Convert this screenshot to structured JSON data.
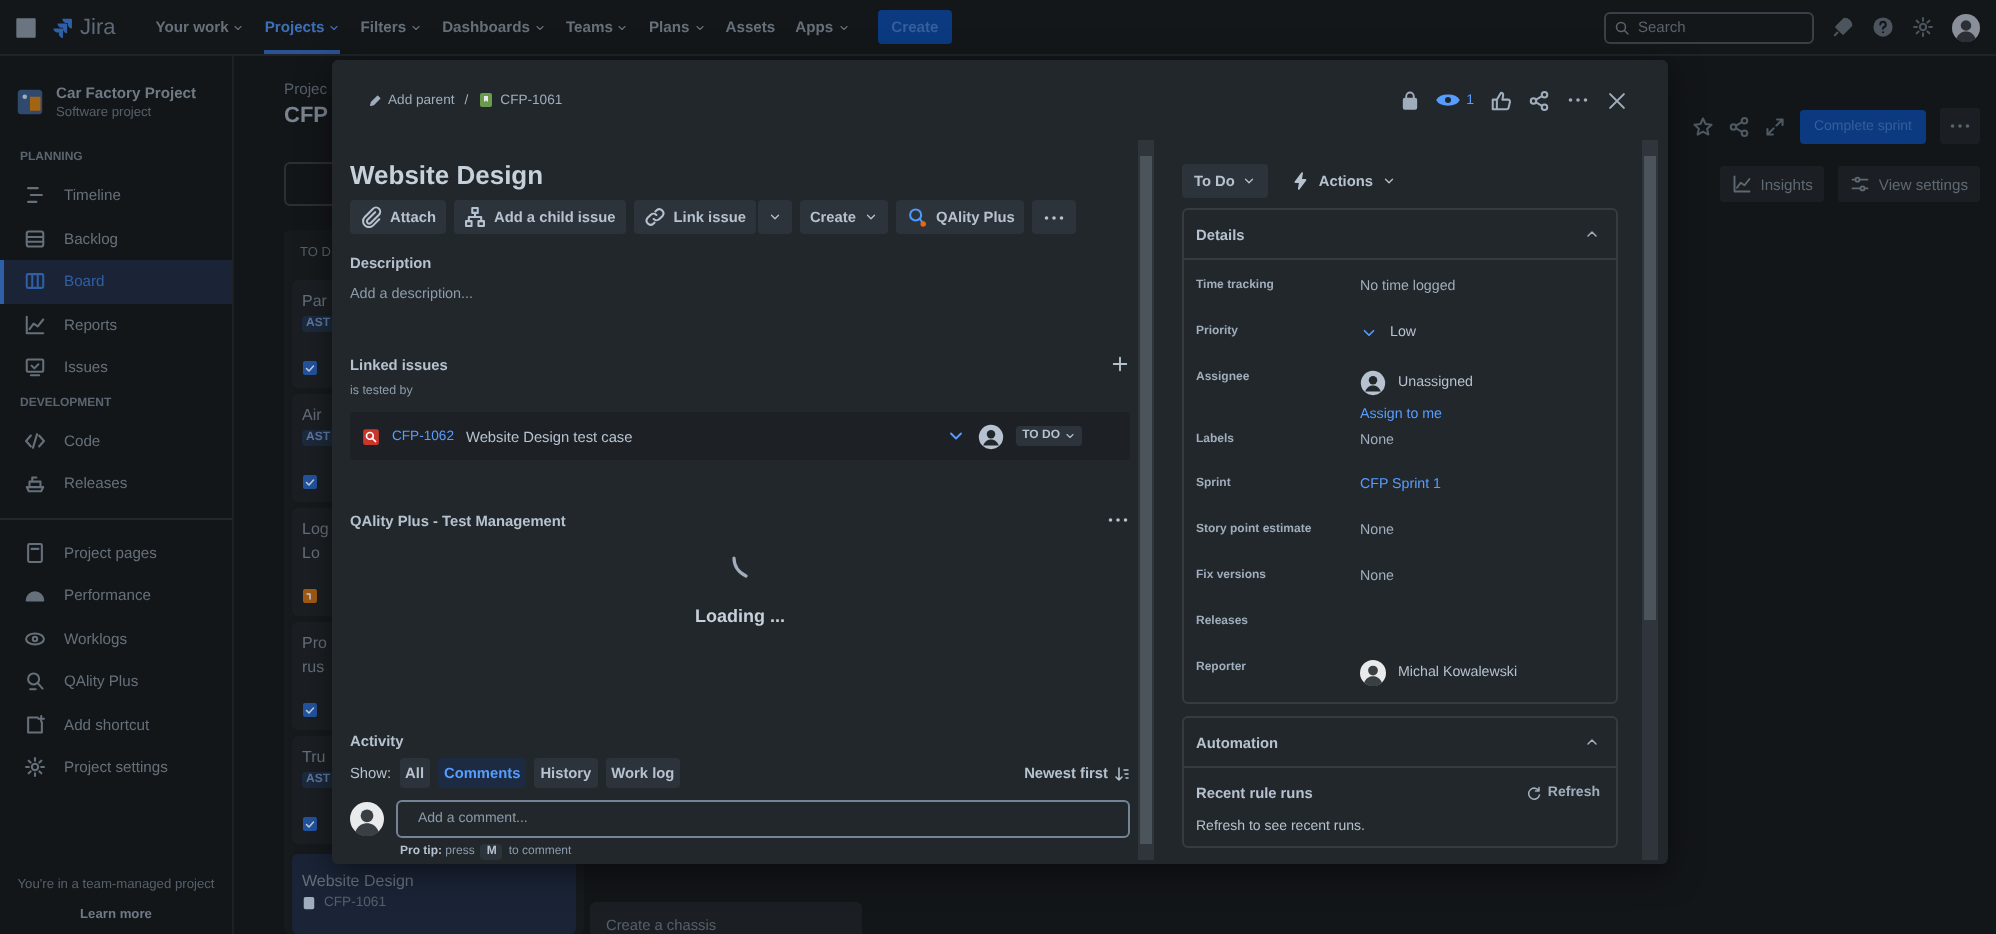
{
  "topnav": {
    "logo": "Jira",
    "items": [
      {
        "label": "Your work",
        "dropdown": true,
        "selected": false
      },
      {
        "label": "Projects",
        "dropdown": true,
        "selected": true
      },
      {
        "label": "Filters",
        "dropdown": true,
        "selected": false
      },
      {
        "label": "Dashboards",
        "dropdown": true,
        "selected": false
      },
      {
        "label": "Teams",
        "dropdown": true,
        "selected": false
      },
      {
        "label": "Plans",
        "dropdown": true,
        "selected": false
      },
      {
        "label": "Assets",
        "dropdown": false,
        "selected": false
      },
      {
        "label": "Apps",
        "dropdown": true,
        "selected": false
      }
    ],
    "create": "Create",
    "search": {
      "placeholder": "Search"
    }
  },
  "sidebar": {
    "project": {
      "name": "Car Factory Project",
      "type": "Software project"
    },
    "groups": [
      {
        "heading": "PLANNING",
        "items": [
          {
            "label": "Timeline",
            "kind": "timeline",
            "selected": false
          },
          {
            "label": "Backlog",
            "kind": "backlog",
            "selected": false
          },
          {
            "label": "Board",
            "kind": "board",
            "selected": true
          },
          {
            "label": "Reports",
            "kind": "reports",
            "selected": false
          },
          {
            "label": "Issues",
            "kind": "issues",
            "selected": false
          }
        ]
      },
      {
        "heading": "DEVELOPMENT",
        "items": [
          {
            "label": "Code",
            "kind": "code",
            "selected": false
          },
          {
            "label": "Releases",
            "kind": "releases",
            "selected": false
          }
        ]
      },
      {
        "items": [
          {
            "label": "Project pages",
            "kind": "pages",
            "selected": false
          },
          {
            "label": "Performance",
            "kind": "performance",
            "selected": false
          },
          {
            "label": "Worklogs",
            "kind": "worklogs",
            "selected": false
          },
          {
            "label": "QAlity Plus",
            "kind": "qality",
            "selected": false
          },
          {
            "label": "Add shortcut",
            "kind": "shortcut",
            "selected": false
          },
          {
            "label": "Project settings",
            "kind": "settings",
            "selected": false
          }
        ]
      }
    ],
    "footer": "You're in a team-managed project",
    "learn_more": "Learn more"
  },
  "board": {
    "breadcrumb": "Projec",
    "title": "CFP",
    "complete_sprint": "Complete sprint",
    "insights": "Insights",
    "view_settings": "View settings",
    "column_header": "TO D",
    "cards": [
      {
        "lines": [
          "Par"
        ],
        "tag": "AST",
        "kind": "task"
      },
      {
        "lines": [
          "Air"
        ],
        "tag": "AST",
        "kind": "task"
      },
      {
        "lines": [
          "Log",
          "Lo"
        ],
        "kind": "other"
      },
      {
        "lines": [
          "Pro",
          "rus"
        ],
        "kind": "task"
      },
      {
        "lines": [
          "Tru"
        ],
        "tag": "AST",
        "kind": "task"
      }
    ],
    "selected_card": {
      "title": "Website Design",
      "key": "CFP-1061"
    },
    "create_card": "Create a chassis"
  },
  "issue": {
    "breadcrumb": {
      "parent": "Add parent",
      "separator": "/",
      "key": "CFP-1061"
    },
    "watchers": "1",
    "title": "Website Design",
    "actions": [
      {
        "label": "Attach",
        "kind": "attach"
      },
      {
        "label": "Add a child issue",
        "kind": "child"
      },
      {
        "label": "Link issue",
        "kind": "link"
      },
      {
        "label": "Create",
        "kind": "create"
      },
      {
        "label": "QAlity Plus",
        "kind": "qality"
      },
      {
        "kind": "more"
      }
    ],
    "description": {
      "heading": "Description",
      "placeholder": "Add a description..."
    },
    "linked": {
      "heading": "Linked issues",
      "relation": "is tested by",
      "items": [
        {
          "key": "CFP-1062",
          "summary": "Website Design test case",
          "status": "TO DO"
        }
      ]
    },
    "qality": {
      "heading": "QAlity Plus - Test Management",
      "loading": "Loading ..."
    },
    "activity": {
      "heading": "Activity",
      "show_label": "Show:",
      "filters": [
        {
          "label": "All",
          "selected": false
        },
        {
          "label": "Comments",
          "selected": true
        },
        {
          "label": "History",
          "selected": false
        },
        {
          "label": "Work log",
          "selected": false
        }
      ],
      "sort": "Newest first",
      "comment": {
        "placeholder": "Add a comment..."
      },
      "tip": {
        "lead": "**Pro tip:** press",
        "key": "M",
        "after": "to comment"
      }
    },
    "status": "To Do",
    "actions_label": "Actions",
    "details": {
      "heading": "Details",
      "expanded": true,
      "fields": [
        {
          "label": "Time tracking",
          "kind": "text",
          "value": "No time logged"
        },
        {
          "label": "Priority",
          "kind": "priority",
          "value": "Low"
        },
        {
          "label": "Assignee",
          "kind": "user",
          "value": "Unassigned",
          "link": "Assign to me"
        },
        {
          "label": "Labels",
          "kind": "text",
          "value": "None"
        },
        {
          "label": "Sprint",
          "kind": "link",
          "value": "CFP Sprint 1"
        },
        {
          "label": "Story point estimate",
          "kind": "text",
          "value": "None"
        },
        {
          "label": "Fix versions",
          "kind": "text",
          "value": "None"
        },
        {
          "label": "Releases",
          "kind": "empty"
        },
        {
          "label": "Reporter",
          "kind": "photo",
          "value": "Michal Kowalewski"
        }
      ]
    },
    "automation": {
      "heading": "Automation",
      "expanded": true,
      "recent": "Recent rule runs",
      "refresh": "Refresh",
      "hint": "Refresh to see recent runs."
    }
  }
}
